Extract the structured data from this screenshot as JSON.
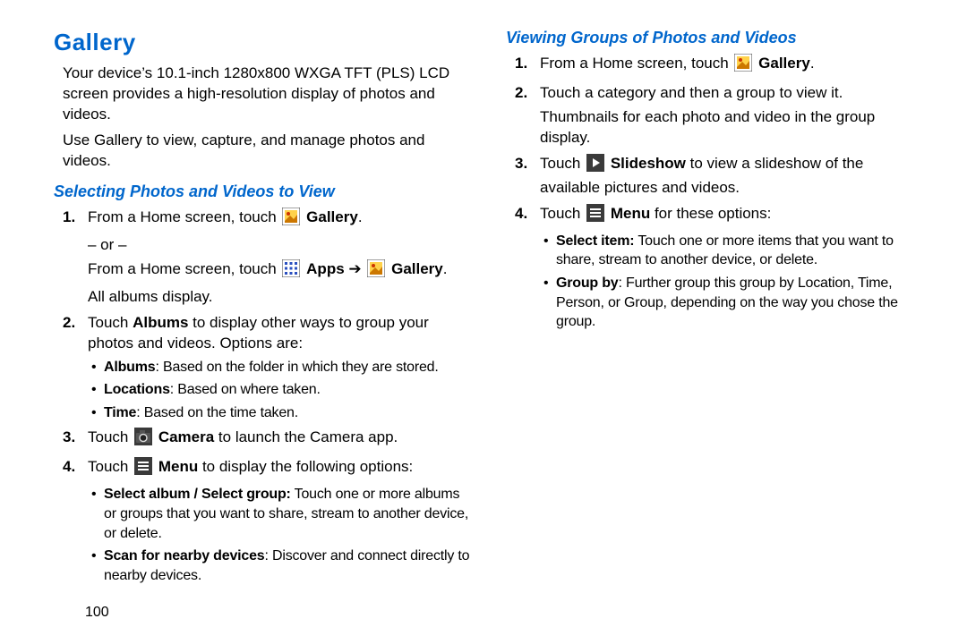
{
  "title": "Gallery",
  "intro1": "Your device’s 10.1-inch 1280x800 WXGA TFT (PLS) LCD screen provides a high-resolution display of photos and videos.",
  "intro2": "Use Gallery to view, capture, and manage photos and videos.",
  "sectionA": {
    "heading": "Selecting Photos and Videos to View",
    "step1_a": "From a Home screen, touch ",
    "step1_gallery": "Gallery",
    "step1_dot": ".",
    "or": "– or –",
    "step1b_a": "From a Home screen, touch ",
    "step1b_apps": "Apps",
    "step1b_arrow": " ➔ ",
    "step1b_gallery": "Gallery",
    "step1b_dot": ".",
    "step1c": "All albums display.",
    "step2_a": "Touch ",
    "step2_bold": "Albums",
    "step2_b": " to display other ways to group your photos and videos. Options are:",
    "b1_bold": "Albums",
    "b1_text": ": Based on the folder in which they are stored.",
    "b2_bold": "Locations",
    "b2_text": ": Based on where taken.",
    "b3_bold": "Time",
    "b3_text": ": Based on the time taken.",
    "step3_a": "Touch ",
    "step3_bold": "Camera",
    "step3_b": " to launch the Camera app.",
    "step4_a": "Touch ",
    "step4_bold": "Menu",
    "step4_b": " to display the following options:",
    "b4_bold": "Select album / Select group:",
    "b4_text": " Touch one or more albums or groups that you want to share, stream to another device, or delete.",
    "b5_bold": "Scan for nearby devices",
    "b5_text": ": Discover and connect directly to nearby devices."
  },
  "sectionB": {
    "heading": "Viewing Groups of Photos and Videos",
    "step1_a": "From a Home screen, touch ",
    "step1_gallery": "Gallery",
    "step1_dot": ".",
    "step2": "Touch a category and then a group to view it.",
    "step2b": "Thumbnails for each photo and video in the group display.",
    "step3_a": "Touch ",
    "step3_bold": "Slideshow",
    "step3_b": " to view a slideshow of the available pictures and videos.",
    "step4_a": "Touch ",
    "step4_bold": "Menu",
    "step4_b": " for these options:",
    "b1_bold": "Select item:",
    "b1_text": " Touch one or more items that you want to share, stream to another device, or delete.",
    "b2_bold": "Group by",
    "b2_text": ": Further group this group by Location, Time, Person, or Group, depending on the way you chose the group."
  },
  "pagenum": "100",
  "nums": {
    "n1": "1.",
    "n2": "2.",
    "n3": "3.",
    "n4": "4."
  }
}
